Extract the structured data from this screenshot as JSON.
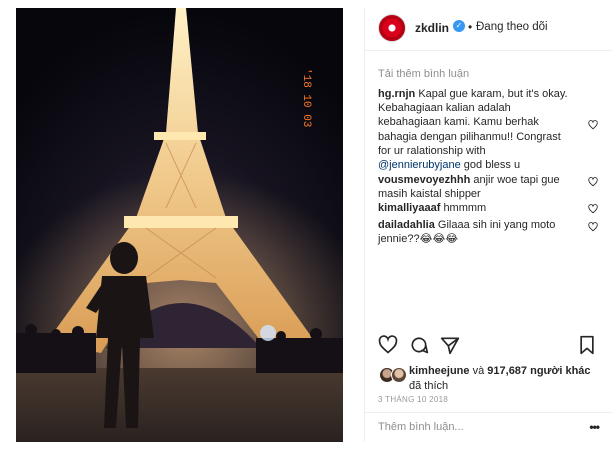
{
  "post": {
    "username": "zkdlin",
    "follow_status": "Đang theo dõi",
    "separator": "•",
    "verified_mark": "✓",
    "photo": {
      "date_stamp": "'18 10 03",
      "description": "Eiffel Tower lit at night"
    }
  },
  "comments": {
    "load_more": "Tải thêm bình luận",
    "items": [
      {
        "user": "hg.rnjn",
        "text_lines": [
          "Kapal gue karam, but it's okay.",
          "Kebahagiaan kalian adalah",
          "kebahagiaan kami. Kamu berhak",
          "bahagia dengan pilihanmu!! Congrast",
          "for ur ralationship with"
        ],
        "mention": "@jennierubyjane",
        "after_mention": "god bless u"
      },
      {
        "user": "vousmevoyezhhh",
        "text_lines": [
          "anjir woe tapi gue",
          "masih kaistal shipper"
        ]
      },
      {
        "user": "kimalliyaaaf",
        "text_lines": [
          "hmmmm"
        ]
      },
      {
        "user": "dailadahlia",
        "text_lines": [
          "Gilaaa sih ini yang moto",
          "jennie??😂😂😂"
        ]
      }
    ]
  },
  "actions": {
    "like_icon": "heart-outline-icon",
    "comment_icon": "comment-icon",
    "share_icon": "share-icon",
    "save_icon": "bookmark-icon"
  },
  "likes": {
    "first_liker": "kimheejune",
    "connector": "và",
    "count": "917,687",
    "others": "người khác",
    "suffix": "đã thích"
  },
  "date": "3 THÁNG 10 2018",
  "add_comment": {
    "placeholder": "Thêm bình luận...",
    "options": "•••"
  },
  "colors": {
    "link": "#003569",
    "verified": "#3897f0",
    "muted": "#8e8e8e",
    "border": "#efefef"
  }
}
